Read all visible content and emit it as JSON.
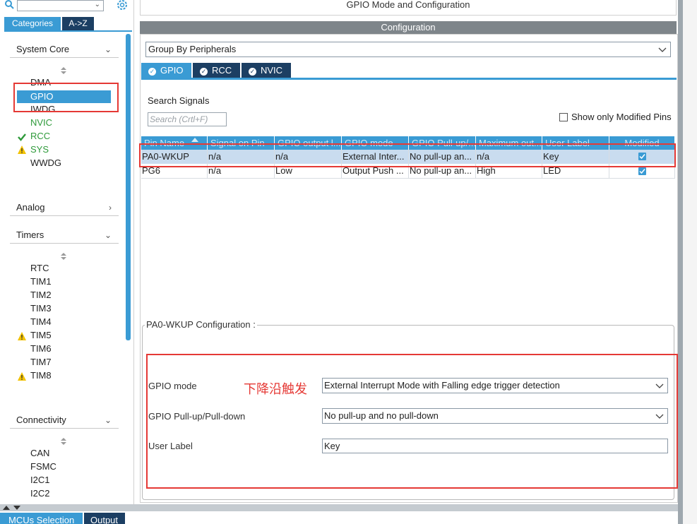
{
  "left_panel": {
    "tabs": {
      "categories": "Categories",
      "az": "A->Z"
    },
    "sections": {
      "system_core": {
        "title": "System Core",
        "items": [
          "DMA",
          "GPIO",
          "IWDG",
          "NVIC",
          "RCC",
          "SYS",
          "WWDG"
        ]
      },
      "analog": {
        "title": "Analog"
      },
      "timers": {
        "title": "Timers",
        "items": [
          "RTC",
          "TIM1",
          "TIM2",
          "TIM3",
          "TIM4",
          "TIM5",
          "TIM6",
          "TIM7",
          "TIM8"
        ]
      },
      "connectivity": {
        "title": "Connectivity",
        "items": [
          "CAN",
          "FSMC",
          "I2C1",
          "I2C2"
        ]
      }
    }
  },
  "header": {
    "title": "GPIO Mode and Configuration"
  },
  "config": {
    "header": "Configuration",
    "group_by": "Group By Peripherals",
    "tabs": [
      "GPIO",
      "RCC",
      "NVIC"
    ],
    "search_label": "Search Signals",
    "search_placeholder": "Search (Crtl+F)",
    "show_modified": "Show only Modified Pins",
    "table": {
      "columns": [
        "Pin Name",
        "Signal on Pin",
        "GPIO output l...",
        "GPIO mode",
        "GPIO Pull-up/...",
        "Maximum out...",
        "User Label",
        "Modified"
      ],
      "rows": [
        [
          "PA0-WKUP",
          "n/a",
          "n/a",
          "External Inter...",
          "No pull-up an...",
          "n/a",
          "Key"
        ],
        [
          "PG6",
          "n/a",
          "Low",
          "Output Push ...",
          "No pull-up an...",
          "High",
          "LED"
        ]
      ]
    }
  },
  "pin_config": {
    "title": "PA0-WKUP Configuration :",
    "gpio_mode_label": "GPIO mode",
    "gpio_mode_value": "External Interrupt Mode with Falling edge trigger detection",
    "pull_label": "GPIO Pull-up/Pull-down",
    "pull_value": "No pull-up and no pull-down",
    "user_label_label": "User Label",
    "user_label_value": "Key",
    "annotation": "下降沿触发"
  },
  "bottom_tabs": {
    "mcu": "MCUs Selection",
    "output": "Output"
  },
  "colors": {
    "accent": "#3a9bd4",
    "dark_tab": "#1c3f63",
    "annotation_red": "#e53935",
    "ok_green": "#2e9a3a",
    "warn_yellow": "#f2c200"
  }
}
